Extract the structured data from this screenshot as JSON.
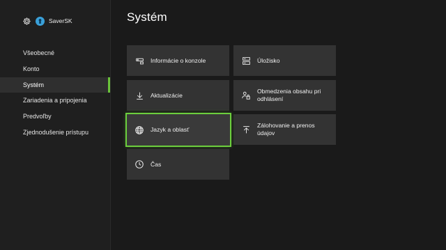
{
  "profile": {
    "gear_icon": "gear-icon",
    "avatar_icon": "gamerpic-avatar",
    "gamertag": "SaverSK"
  },
  "sidebar": {
    "items": [
      {
        "label": "Všeobecné",
        "active": false
      },
      {
        "label": "Konto",
        "active": false
      },
      {
        "label": "Systém",
        "active": true
      },
      {
        "label": "Zariadenia a pripojenia",
        "active": false
      },
      {
        "label": "Predvoľby",
        "active": false
      },
      {
        "label": "Zjednodušenie prístupu",
        "active": false
      }
    ]
  },
  "main": {
    "title": "Systém",
    "tiles": [
      {
        "label": "Informácie o konzole",
        "icon": "console-icon"
      },
      {
        "label": "Úložisko",
        "icon": "storage-icon"
      },
      {
        "label": "Aktualizácie",
        "icon": "download-icon"
      },
      {
        "label": "Obmedzenia obsahu pri odhlásení",
        "icon": "users-lock-icon"
      },
      {
        "label": "Jazyk a oblasť",
        "icon": "globe-icon",
        "focused": true
      },
      {
        "label": "Zálohovanie a prenos údajov",
        "icon": "upload-icon"
      },
      {
        "label": "Čas",
        "icon": "clock-icon"
      }
    ]
  },
  "colors": {
    "accent": "#6ccf3d",
    "background": "#1a1a1a",
    "tile": "#333333"
  }
}
